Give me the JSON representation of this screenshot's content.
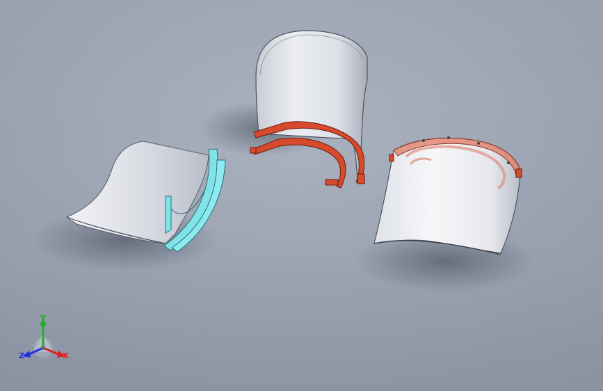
{
  "viewport": {
    "background": [
      "#a9b1bf",
      "#8b93a3"
    ]
  },
  "models": [
    {
      "id": "faceshield-exploded-left",
      "frame_color": "#7fe3e8",
      "visor_color": "#e6e8ee"
    },
    {
      "id": "faceshield-exploded-center",
      "frame_color": "#d84a2c",
      "visor_color": "#e9ebef"
    },
    {
      "id": "faceshield-assembled-right",
      "frame_color": "#e0806a",
      "visor_color": "#eef0f3"
    }
  ],
  "triad": {
    "labels": {
      "x": "X",
      "y": "Y",
      "z": "Z"
    },
    "colors": {
      "x": "#e02020",
      "y": "#20b020",
      "z": "#2030e0"
    }
  }
}
